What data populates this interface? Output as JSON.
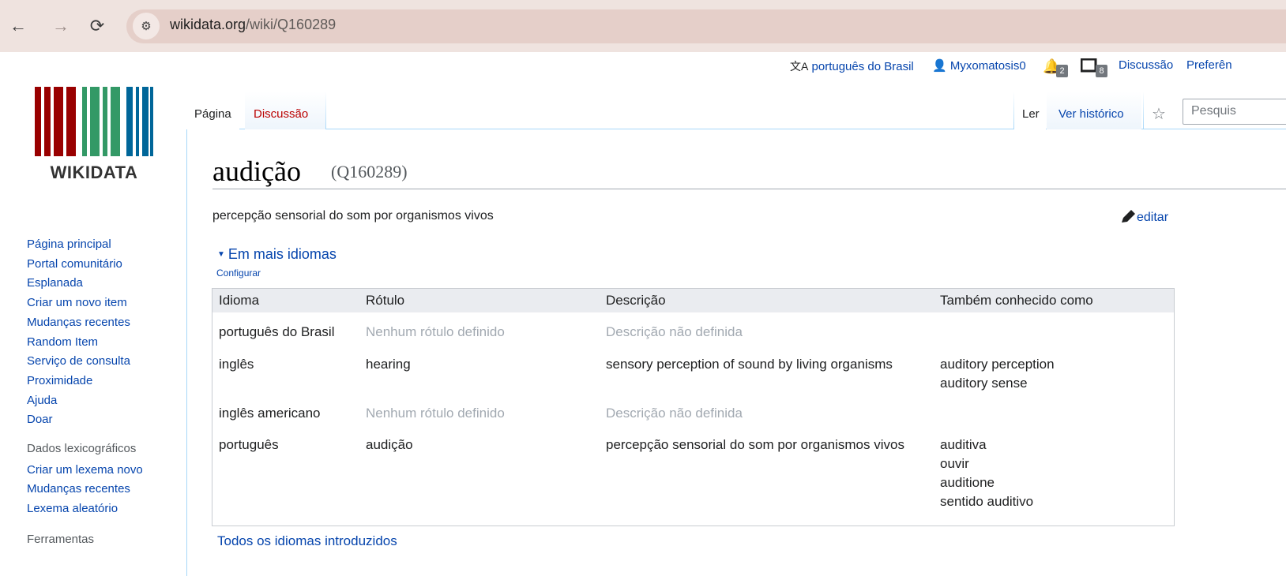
{
  "browser": {
    "url_host": "wikidata.org",
    "url_path": "/wiki/Q160289"
  },
  "logo": {
    "wordmark": "WIKIDATA"
  },
  "personal": {
    "language": "português do Brasil",
    "username": "Myxomatosis0",
    "notifications_count": "2",
    "messages_count": "8",
    "talk": "Discussão",
    "preferences": "Preferên"
  },
  "tabs": {
    "page": "Página",
    "discussion": "Discussão",
    "read": "Ler",
    "history": "Ver histórico"
  },
  "search": {
    "placeholder": "Pesquis"
  },
  "sidebar": {
    "nav": [
      "Página principal",
      "Portal comunitário",
      "Esplanada",
      "Criar um novo item",
      "Mudanças recentes",
      "Random Item",
      "Serviço de consulta",
      "Proximidade",
      "Ajuda",
      "Doar"
    ],
    "lexeme_heading": "Dados lexicográficos",
    "lexeme": [
      "Criar um lexema novo",
      "Mudanças recentes",
      "Lexema aleatório"
    ],
    "tools_heading": "Ferramentas"
  },
  "item": {
    "label": "audição",
    "id": "(Q160289)",
    "description": "percepção sensorial do som por organismos vivos",
    "edit": "editar"
  },
  "languages": {
    "toggle": "Em mais idiomas",
    "configure": "Configurar",
    "headers": [
      "Idioma",
      "Rótulo",
      "Descrição",
      "Também conhecido como"
    ],
    "rows": [
      {
        "lang": "português do Brasil",
        "label": "Nenhum rótulo definido",
        "label_missing": true,
        "desc": "Descrição não definida",
        "desc_missing": true,
        "aliases": []
      },
      {
        "lang": "inglês",
        "label": "hearing",
        "label_missing": false,
        "desc": "sensory perception of sound by living organisms",
        "desc_missing": false,
        "aliases": [
          "auditory perception",
          "auditory sense"
        ]
      },
      {
        "lang": "inglês americano",
        "label": "Nenhum rótulo definido",
        "label_missing": true,
        "desc": "Descrição não definida",
        "desc_missing": true,
        "aliases": []
      },
      {
        "lang": "português",
        "label": "audição",
        "label_missing": false,
        "desc": "percepção sensorial do som por organismos vivos",
        "desc_missing": false,
        "aliases": [
          "auditiva",
          "ouvir",
          "auditione",
          "sentido auditivo"
        ]
      }
    ],
    "all_languages": "Todos os idiomas introduzidos"
  }
}
